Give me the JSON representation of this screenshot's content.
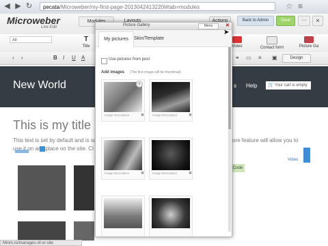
{
  "browser": {
    "url_host": "pecata",
    "url_path": "/Microweber/my-first-page-2013042413220l#tab=modules"
  },
  "editor": {
    "logo": "Microweber",
    "logo_sub": "Live Edit",
    "tab_modules": "Modules",
    "tab_layouts": "Layouts",
    "actions_label": "Actions",
    "back_to_admin_label": "Back to Admin",
    "save_label": "Save",
    "category_select": "All",
    "modules": [
      {
        "label": "Title",
        "icon": "title-icon"
      },
      {
        "label": "Video",
        "icon": "video-icon"
      },
      {
        "label": "Contact form",
        "icon": "contact-form-icon"
      },
      {
        "label": "Picture Ga",
        "icon": "picture-gallery-icon"
      }
    ],
    "format_buttons": [
      "B",
      "I",
      "U",
      "A"
    ],
    "design_label": "Design"
  },
  "site": {
    "title": "New World",
    "nav_partial": "s",
    "nav_help": "Help",
    "cart_text": "Your cart is empty"
  },
  "page": {
    "heading": "This is my title",
    "paragraph_line1": "This text is set by default and is su",
    "paragraph_line2": "use it on any place on the site. Cl",
    "paragraph_right": "ore feature will allow you to",
    "code_chip": "Code",
    "video_link": "Video",
    "status_text": "Mmm.ro/manages-of-or-site"
  },
  "modal": {
    "title": "Picture Gallery",
    "menu_label": "Menu",
    "tabs": [
      "My pictures",
      "Skin/Template"
    ],
    "checkbox_label": "Use pictures from post",
    "add_images_label": "Add images",
    "add_images_hint": "(The first image will be thumbnail)",
    "image_caption": "Image Description",
    "images": [
      {
        "name": "image-1",
        "tone": "#6e6e6e"
      },
      {
        "name": "image-2",
        "tone": "#2b2b2b"
      },
      {
        "name": "image-3",
        "tone": "#4a4a4a"
      },
      {
        "name": "image-4",
        "tone": "#1b1b1b"
      },
      {
        "name": "image-5",
        "tone": "#7a7a7a"
      },
      {
        "name": "image-6",
        "tone": "#3a3a3a"
      }
    ]
  },
  "colors": {
    "header_bg": "#363c44",
    "save_green": "#9fd46a",
    "accent_blue": "#3c8fd8"
  }
}
